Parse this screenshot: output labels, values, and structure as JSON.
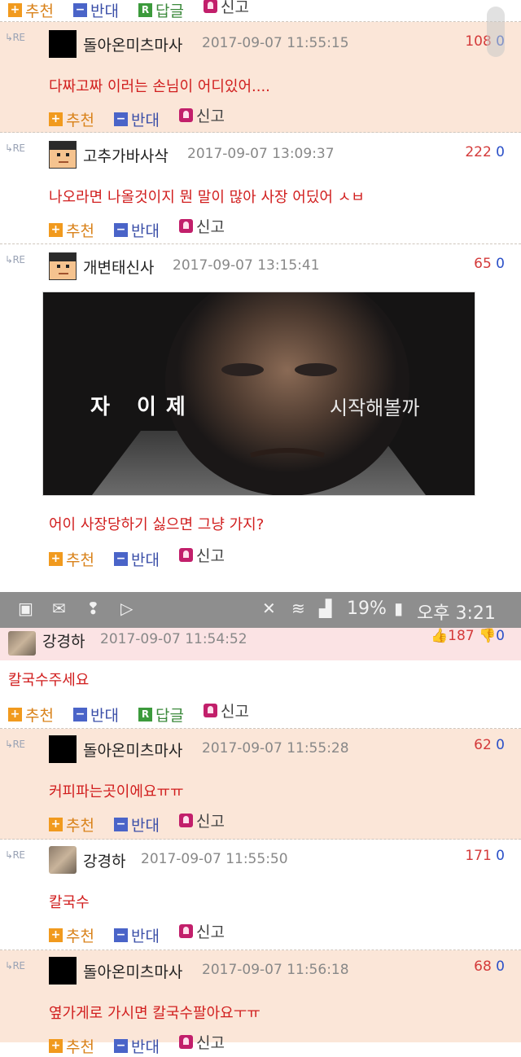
{
  "actions": {
    "recommend": "추천",
    "oppose": "반대",
    "reply": "답글",
    "report": "신고"
  },
  "top_partial": {
    "recommend": "추천",
    "oppose": "반대",
    "reply": "답글",
    "report": "신고"
  },
  "comments": [
    {
      "nick": "돌아온미츠마사",
      "date": "2017-09-07 11:55:15",
      "up": "108",
      "down": "0",
      "text": "다짜고짜 이러는 손님이 어디있어....",
      "avatar": "black-box"
    },
    {
      "nick": "고추가바사삭",
      "date": "2017-09-07 13:09:37",
      "up": "222",
      "down": "0",
      "text": "나오라면 나올것이지 뭔 말이 많아 사장 어딨어 ㅅㅂ",
      "avatar": "pixel-face"
    },
    {
      "nick": "개변태신사",
      "date": "2017-09-07 13:15:41",
      "up": "65",
      "down": "0",
      "text": "어이 사장당하기 싫으면 그냥 가지?",
      "avatar": "pixel-face"
    },
    {
      "nick": "돌아온미츠마사",
      "date": "2017-09-07 11:55:28",
      "up": "62",
      "down": "0",
      "text": "커피파는곳이에요ㅠㅠ",
      "avatar": "black-box"
    },
    {
      "nick": "강경하",
      "date": "2017-09-07 11:55:50",
      "up": "171",
      "down": "0",
      "text": "칼국수",
      "avatar": "photo"
    },
    {
      "nick": "돌아온미츠마사",
      "date": "2017-09-07 11:56:18",
      "up": "68",
      "down": "0",
      "text": "옆가게로 가시면 칼국수팔아요ㅜㅠ",
      "avatar": "black-box"
    }
  ],
  "movie_still": {
    "subtitle_left": "자 이제",
    "subtitle_right": "시작해볼까"
  },
  "status_bar": {
    "battery": "19%",
    "time": "오후 3:21",
    "icons": [
      "gallery-icon",
      "mail-icon",
      "notification-icon",
      "play-store-icon",
      "mute-icon",
      "wifi-icon",
      "signal-icon",
      "battery-icon"
    ]
  },
  "parent_comment": {
    "nick": "강경하",
    "date": "2017-09-07 11:54:52",
    "up": "187",
    "down": "0",
    "text": "칼국수주세요"
  },
  "colors": {
    "peach": "#fbe6d8",
    "red_text": "#d11e1e",
    "up": "#d43a3a",
    "down": "#2b50c8",
    "statusbar": "#8e8e8e"
  }
}
